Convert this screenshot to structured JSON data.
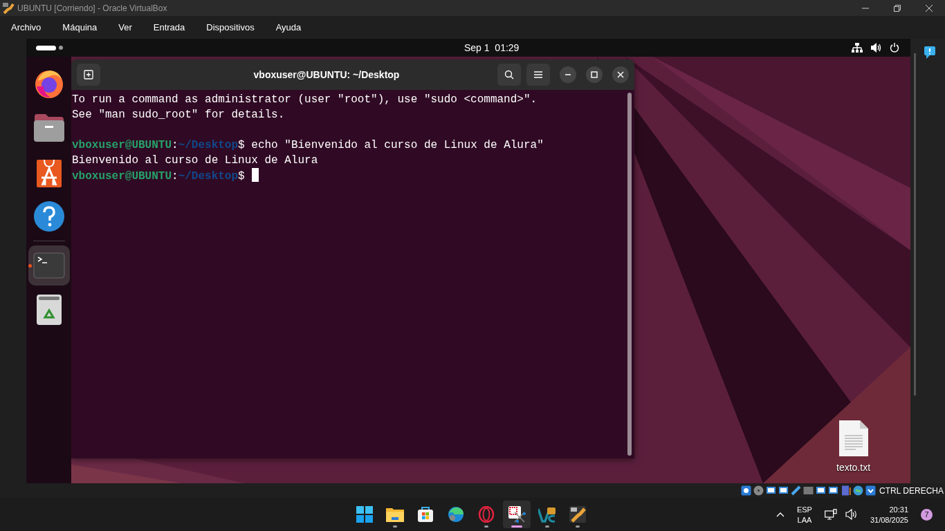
{
  "host_window": {
    "title": "UBUNTU [Corriendo] - Oracle VirtualBox",
    "menu": [
      "Archivo",
      "Máquina",
      "Ver",
      "Entrada",
      "Dispositivos",
      "Ayuda"
    ]
  },
  "vm": {
    "top_bar": {
      "clock": "Sep 1  01:29"
    },
    "dock": [
      {
        "kind": "firefox",
        "running": false,
        "selected": false
      },
      {
        "kind": "files",
        "running": false,
        "selected": false
      },
      {
        "kind": "appcenter",
        "running": false,
        "selected": false
      },
      {
        "kind": "help",
        "running": false,
        "selected": false
      },
      {
        "kind": "terminal",
        "running": true,
        "selected": true
      },
      {
        "kind": "trash",
        "running": false,
        "selected": false
      }
    ],
    "terminal": {
      "title": "vboxuser@UBUNTU: ~/Desktop",
      "lines": [
        {
          "kind": "text",
          "text": "To run a command as administrator (user \"root\"), use \"sudo <command>\"."
        },
        {
          "kind": "text",
          "text": "See \"man sudo_root\" for details."
        },
        {
          "kind": "blank"
        },
        {
          "kind": "prompt",
          "user": "vboxuser@UBUNTU",
          "separator": ":",
          "path": "~/Desktop",
          "symbol": "$",
          "command": "echo \"Bienvenido al curso de Linux de Alura\""
        },
        {
          "kind": "text",
          "text": "Bienvenido al curso de Linux de Alura"
        },
        {
          "kind": "prompt",
          "user": "vboxuser@UBUNTU",
          "separator": ":",
          "path": "~/Desktop",
          "symbol": "$",
          "cursor": true
        }
      ]
    },
    "desktop_icons": [
      {
        "label": "texto.txt"
      }
    ]
  },
  "vbox_status": {
    "host_key": "CTRL DERECHA"
  },
  "taskbar": {
    "apps": [
      {
        "kind": "start",
        "running": false,
        "active": false
      },
      {
        "kind": "explorer",
        "running": true,
        "active": false
      },
      {
        "kind": "store",
        "running": false,
        "active": false
      },
      {
        "kind": "edge",
        "running": false,
        "active": false
      },
      {
        "kind": "opera",
        "running": true,
        "active": false
      },
      {
        "kind": "snip",
        "running": true,
        "active": true
      },
      {
        "kind": "vs",
        "running": true,
        "active": false
      },
      {
        "kind": "virtualbox",
        "running": true,
        "active": false
      }
    ],
    "tray": {
      "language": "ESP",
      "layout": "LAA",
      "time": "20:31",
      "date": "31/08/2025",
      "notifications": "7"
    }
  }
}
